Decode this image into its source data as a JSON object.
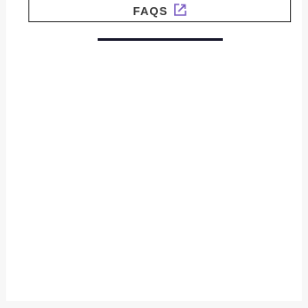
{
  "faqs_button": {
    "label": "FAQS",
    "icon": "external-link-icon"
  },
  "colors": {
    "icon_accent": "#7a5cc2",
    "divider": "#17172b",
    "border": "#222222",
    "page_background": "#f7f7f7"
  }
}
